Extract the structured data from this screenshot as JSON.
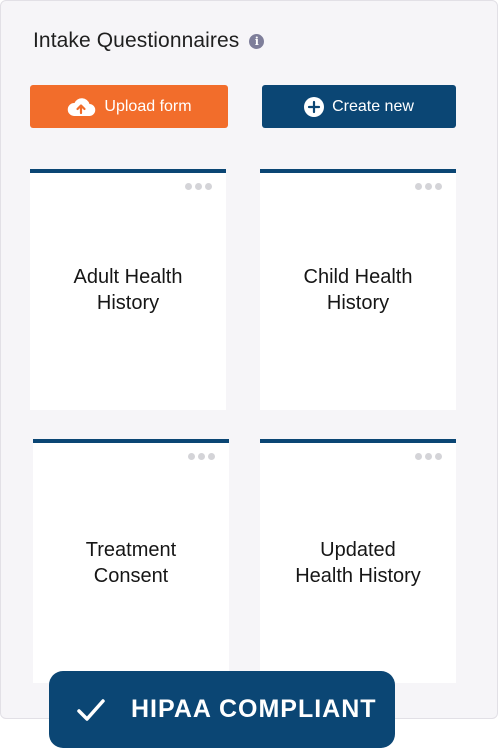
{
  "header": {
    "title": "Intake Questionnaires"
  },
  "actions": {
    "upload_label": "Upload form",
    "create_label": "Create new"
  },
  "forms": [
    {
      "line1": "Adult Health",
      "line2": "History"
    },
    {
      "line1": "Child Health",
      "line2": "History"
    },
    {
      "line1": "Treatment",
      "line2": "Consent"
    },
    {
      "line1": "Updated",
      "line2": "Health History"
    }
  ],
  "badge": {
    "label": "HIPAA COMPLIANT"
  },
  "colors": {
    "accent_orange": "#f26d2b",
    "brand_navy": "#0b4674"
  },
  "icons": {
    "info": "info-icon",
    "upload": "cloud-upload-icon",
    "create": "plus-circle-icon",
    "menu": "more-dots-icon",
    "badge": "checkmark-icon"
  }
}
